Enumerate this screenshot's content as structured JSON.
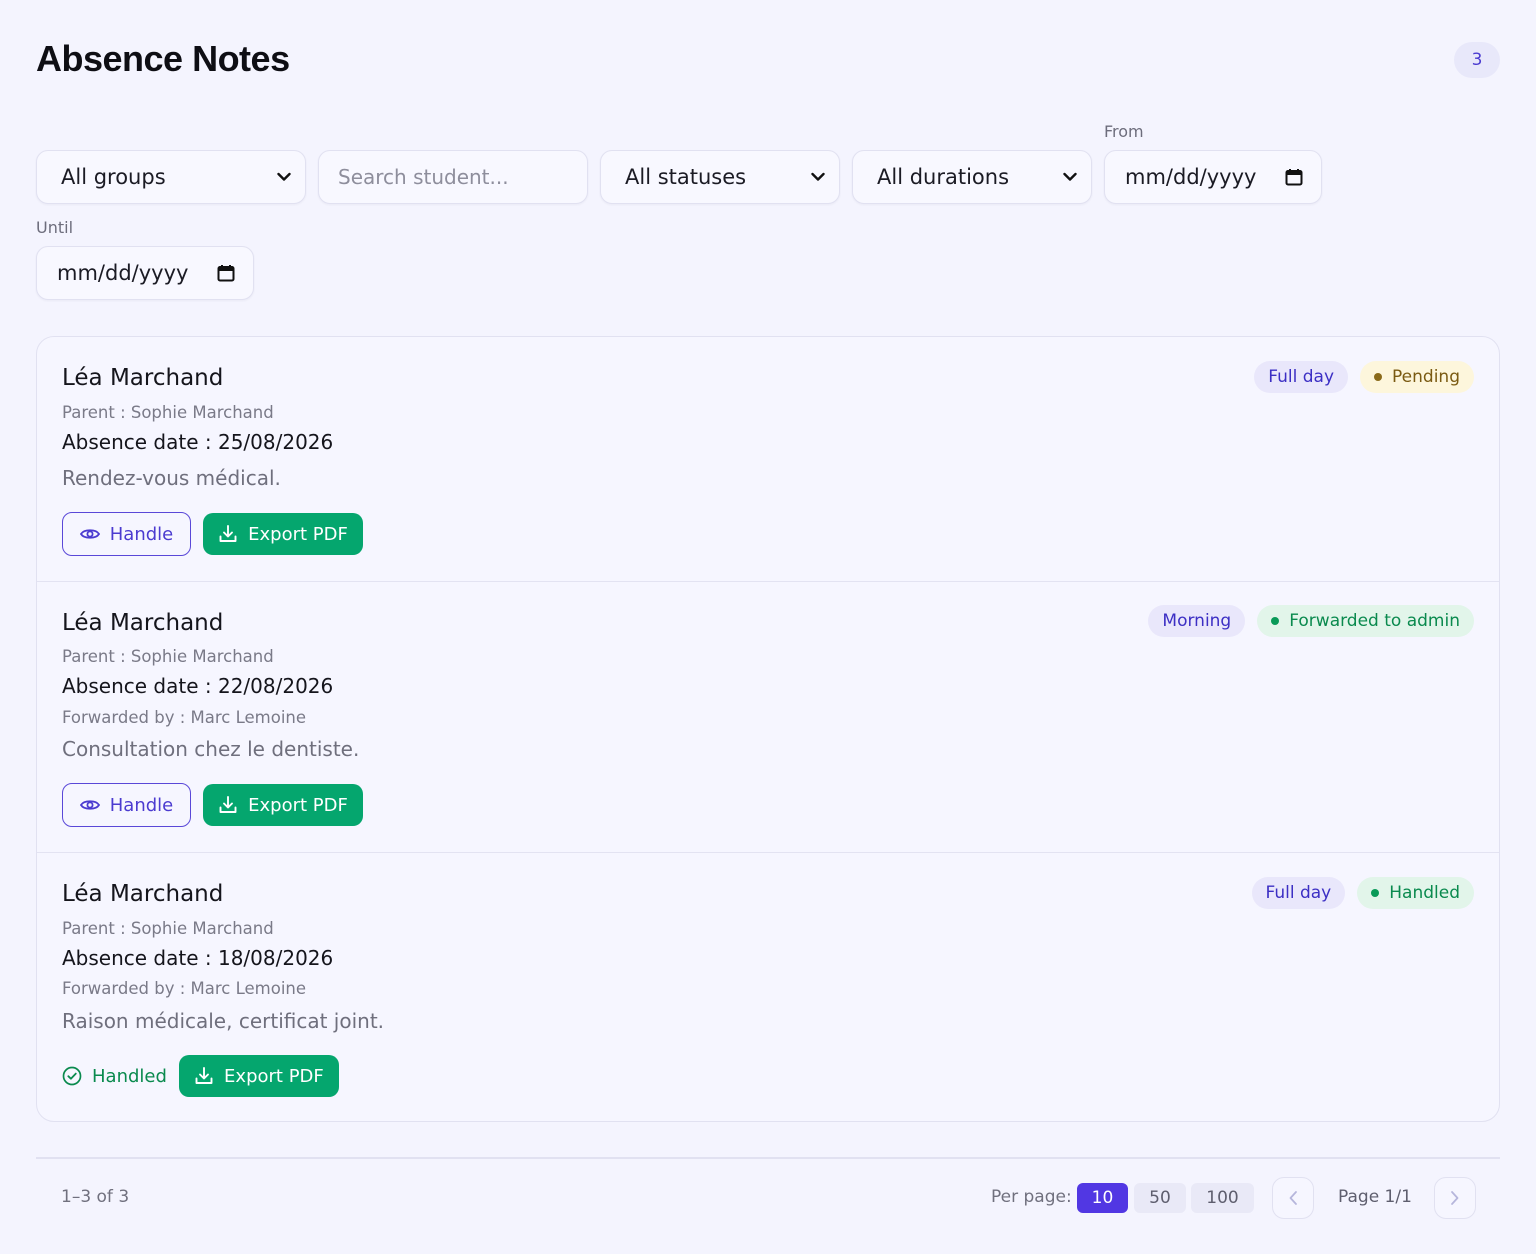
{
  "header": {
    "title": "Absence Notes",
    "count": "3"
  },
  "filters": {
    "group": "All groups",
    "search_placeholder": "Search student...",
    "status": "All statuses",
    "duration": "All durations",
    "from_label": "From",
    "from_value": "mm/dd/yyyy",
    "until_label": "Until",
    "until_value": "mm/dd/yyyy"
  },
  "notes": [
    {
      "student": "Léa Marchand",
      "parent": "Parent : Sophie Marchand",
      "absence_date": "Absence date : 25/08/2026",
      "forwarded_by": "",
      "reason": "Rendez-vous médical.",
      "duration_tag": "Full day",
      "status_tag": "Pending",
      "status_color": "#8a6a1a",
      "handle_label": "Handle",
      "export_label": "Export PDF"
    },
    {
      "student": "Léa Marchand",
      "parent": "Parent : Sophie Marchand",
      "absence_date": "Absence date : 22/08/2026",
      "forwarded_by": "Forwarded by : Marc Lemoine",
      "reason": "Consultation chez le dentiste.",
      "duration_tag": "Morning",
      "status_tag": "Forwarded to admin",
      "status_color": "#0a9a58",
      "handle_label": "Handle",
      "export_label": "Export PDF"
    },
    {
      "student": "Léa Marchand",
      "parent": "Parent : Sophie Marchand",
      "absence_date": "Absence date : 18/08/2026",
      "forwarded_by": "Forwarded by : Marc Lemoine",
      "reason": "Raison médicale, certificat joint.",
      "duration_tag": "Full day",
      "status_tag": "Handled",
      "status_color": "#0a9a58",
      "handled_label": "Handled",
      "export_label": "Export PDF"
    }
  ],
  "pagination": {
    "range": "1–3 of 3",
    "per_page_label": "Per page:",
    "per_page_options": [
      "10",
      "50",
      "100"
    ],
    "per_page_selected": "10",
    "page_info": "Page 1/1"
  },
  "colors": {
    "accent": "#5137e3",
    "success": "#05a66e",
    "background": "#f4f4fe"
  }
}
